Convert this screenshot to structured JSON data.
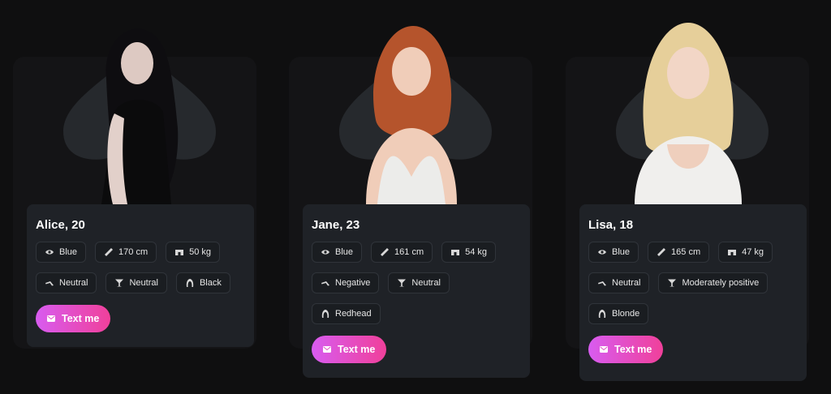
{
  "cards": [
    {
      "title": "Alice, 20",
      "tags": [
        "Blue",
        "170 cm",
        "50 kg",
        "Neutral",
        "Neutral",
        "Black"
      ],
      "button_label": "Text me",
      "hair_color": "#0e0d10",
      "dress_color": "#0b0b0c"
    },
    {
      "title": "Jane, 23",
      "tags": [
        "Blue",
        "161 cm",
        "54 kg",
        "Negative",
        "Neutral",
        "Redhead"
      ],
      "button_label": "Text me",
      "hair_color": "#b5542c",
      "dress_color": "#ececea"
    },
    {
      "title": "Lisa, 18",
      "tags": [
        "Blue",
        "165 cm",
        "47 kg",
        "Neutral",
        "Moderately positive",
        "Blonde"
      ],
      "button_label": "Text me",
      "hair_color": "#e6cf9a",
      "dress_color": "#f0efed"
    }
  ],
  "tag_icons": [
    "eye-icon",
    "ruler-icon",
    "weight-icon",
    "mood-icon",
    "drink-icon",
    "hair-icon"
  ],
  "colors": {
    "background": "#0f0f10",
    "card": "#1f2227",
    "tag_border": "#30343a",
    "button_gradient_start": "#d85cf0",
    "button_gradient_end": "#f0409a"
  }
}
